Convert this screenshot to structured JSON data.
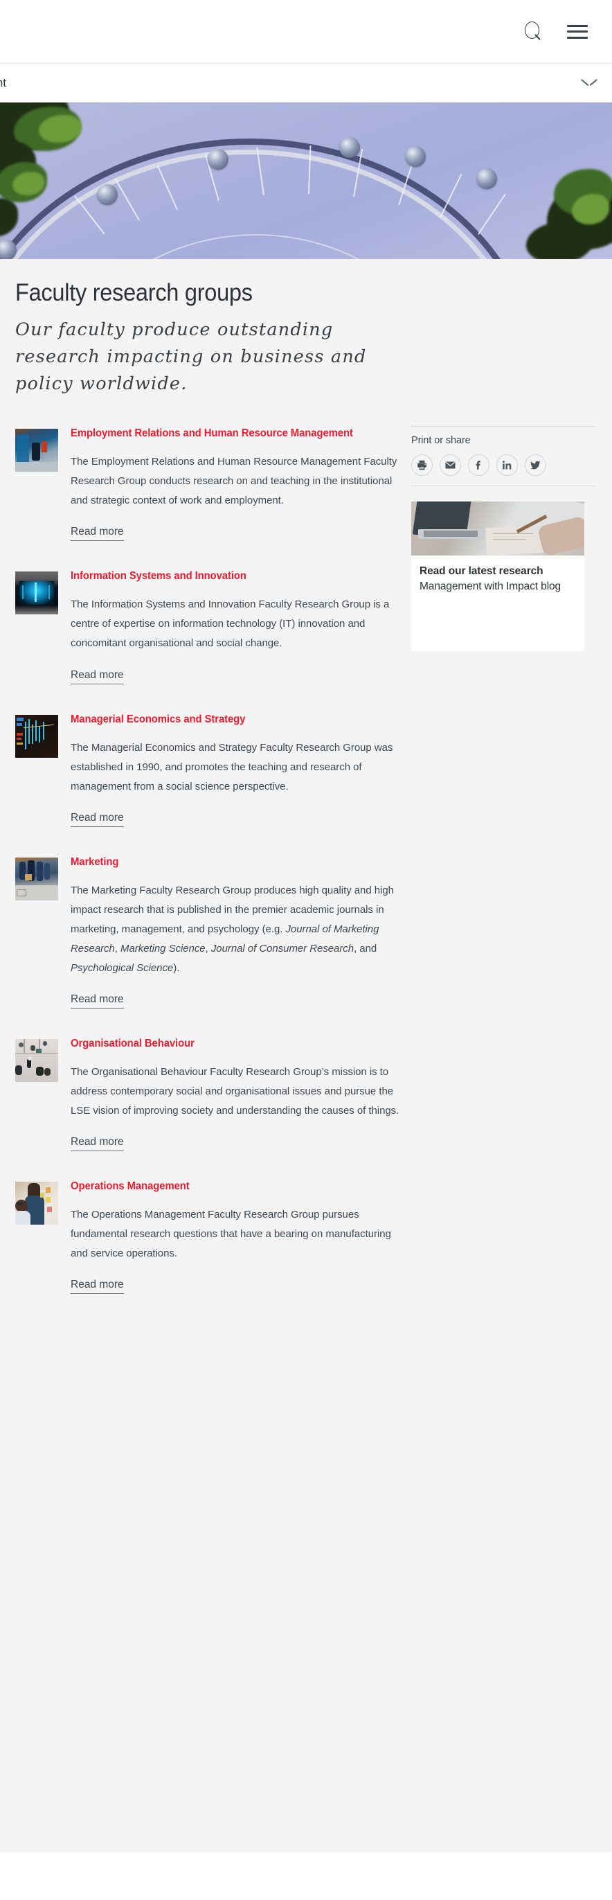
{
  "header": {
    "search_icon": "search-icon",
    "menu_icon": "hamburger-menu-icon"
  },
  "nav": {
    "current_section": "nagement",
    "expand_icon": "chevron-down-icon"
  },
  "hero": {
    "alt": "London Eye observation wheel against a pale blue sky with trees"
  },
  "main": {
    "title": "Faculty research groups",
    "lede": "Our faculty produce outstanding research impacting on business and policy worldwide.",
    "read_more_label": "Read more",
    "groups": [
      {
        "title": "Employment Relations and Human Resource Management",
        "body": "The Employment Relations and Human Resource Management Faculty Research Group conducts research on and teaching in the institutional and strategic context of work and employment.",
        "thumb": "street-scene-thumbnail"
      },
      {
        "title": "Information Systems and Innovation",
        "body": "The Information Systems and Innovation Faculty Research Group is a centre of expertise on information technology (IT) innovation and concomitant organisational and social change.",
        "thumb": "data-visualisation-thumbnail"
      },
      {
        "title": "Managerial Economics and Strategy",
        "body": "The Managerial Economics and Strategy Faculty Research Group was established in 1990, and promotes the teaching and research of management from a social science perspective.",
        "thumb": "stock-chart-thumbnail"
      },
      {
        "title": "Marketing",
        "body_html": "The Marketing Faculty Research Group produces high quality and high impact research that is published in the premier academic journals in marketing, management, and psychology (e.g. <em>Journal of Marketing Research</em>, <em>Marketing Science</em>, <em>Journal of Consumer Research</em>, and <em>Psychological Science</em>).",
        "thumb": "pedestrians-thumbnail"
      },
      {
        "title": "Organisational Behaviour",
        "body": "The Organisational Behaviour Faculty Research Group’s mission is to address contemporary social and organisational issues and pursue the LSE vision of improving society and understanding the causes of things.",
        "thumb": "aerial-crowd-thumbnail"
      },
      {
        "title": "Operations Management",
        "body": "The Operations Management Faculty Research Group pursues fundamental research questions that have a bearing on manufacturing and service operations.",
        "thumb": "sticky-notes-workshop-thumbnail"
      }
    ]
  },
  "sidebar": {
    "share_title": "Print or share",
    "share_icons": [
      {
        "name": "print-icon",
        "label": "Print"
      },
      {
        "name": "email-icon",
        "label": "Email"
      },
      {
        "name": "facebook-icon",
        "label": "Facebook"
      },
      {
        "name": "linkedin-icon",
        "label": "LinkedIn"
      },
      {
        "name": "twitter-icon",
        "label": "Twitter"
      }
    ],
    "promo": {
      "heading": "Read our latest research",
      "subheading": "Management with Impact blog",
      "image": "laptop-notebook-desk-thumbnail"
    }
  },
  "colors": {
    "accent_red": "#ee1b2e",
    "body_text": "#3e4851",
    "page_background": "#f4f4f4",
    "card_background": "#ffffff"
  }
}
